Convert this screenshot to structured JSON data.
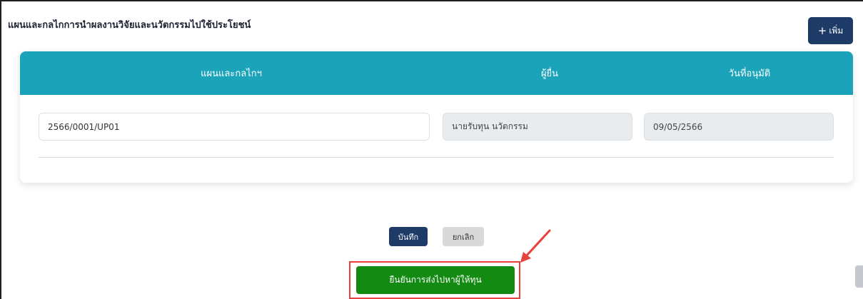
{
  "section": {
    "title": "แผนและกลไกการนำผลงานวิจัยและนวัตกรรมไปใช้ประโยชน์",
    "add_icon": "plus-icon",
    "add_label": "เพิ่ม"
  },
  "table": {
    "headers": [
      "แผนและกลไกฯ",
      "ผู้ยื่น",
      "วันที่อนุมัติ"
    ],
    "row": {
      "plan": "2566/0001/UP01",
      "submitter": "นายรับทุน นวัตกรรม",
      "approved_date": "09/05/2566"
    }
  },
  "actions": {
    "save_label": "บันทึก",
    "cancel_label": "ยกเลิก",
    "confirm_label": "ยืนยันการส่งไปหาผู้ให้ทุน"
  },
  "annotation": {
    "highlight_color": "#e8413c",
    "arrow_icon": "red-arrow-icon"
  },
  "colors": {
    "header_teal": "#1aa3b9",
    "primary_navy": "#1e3a66",
    "confirm_green": "#138a12"
  }
}
